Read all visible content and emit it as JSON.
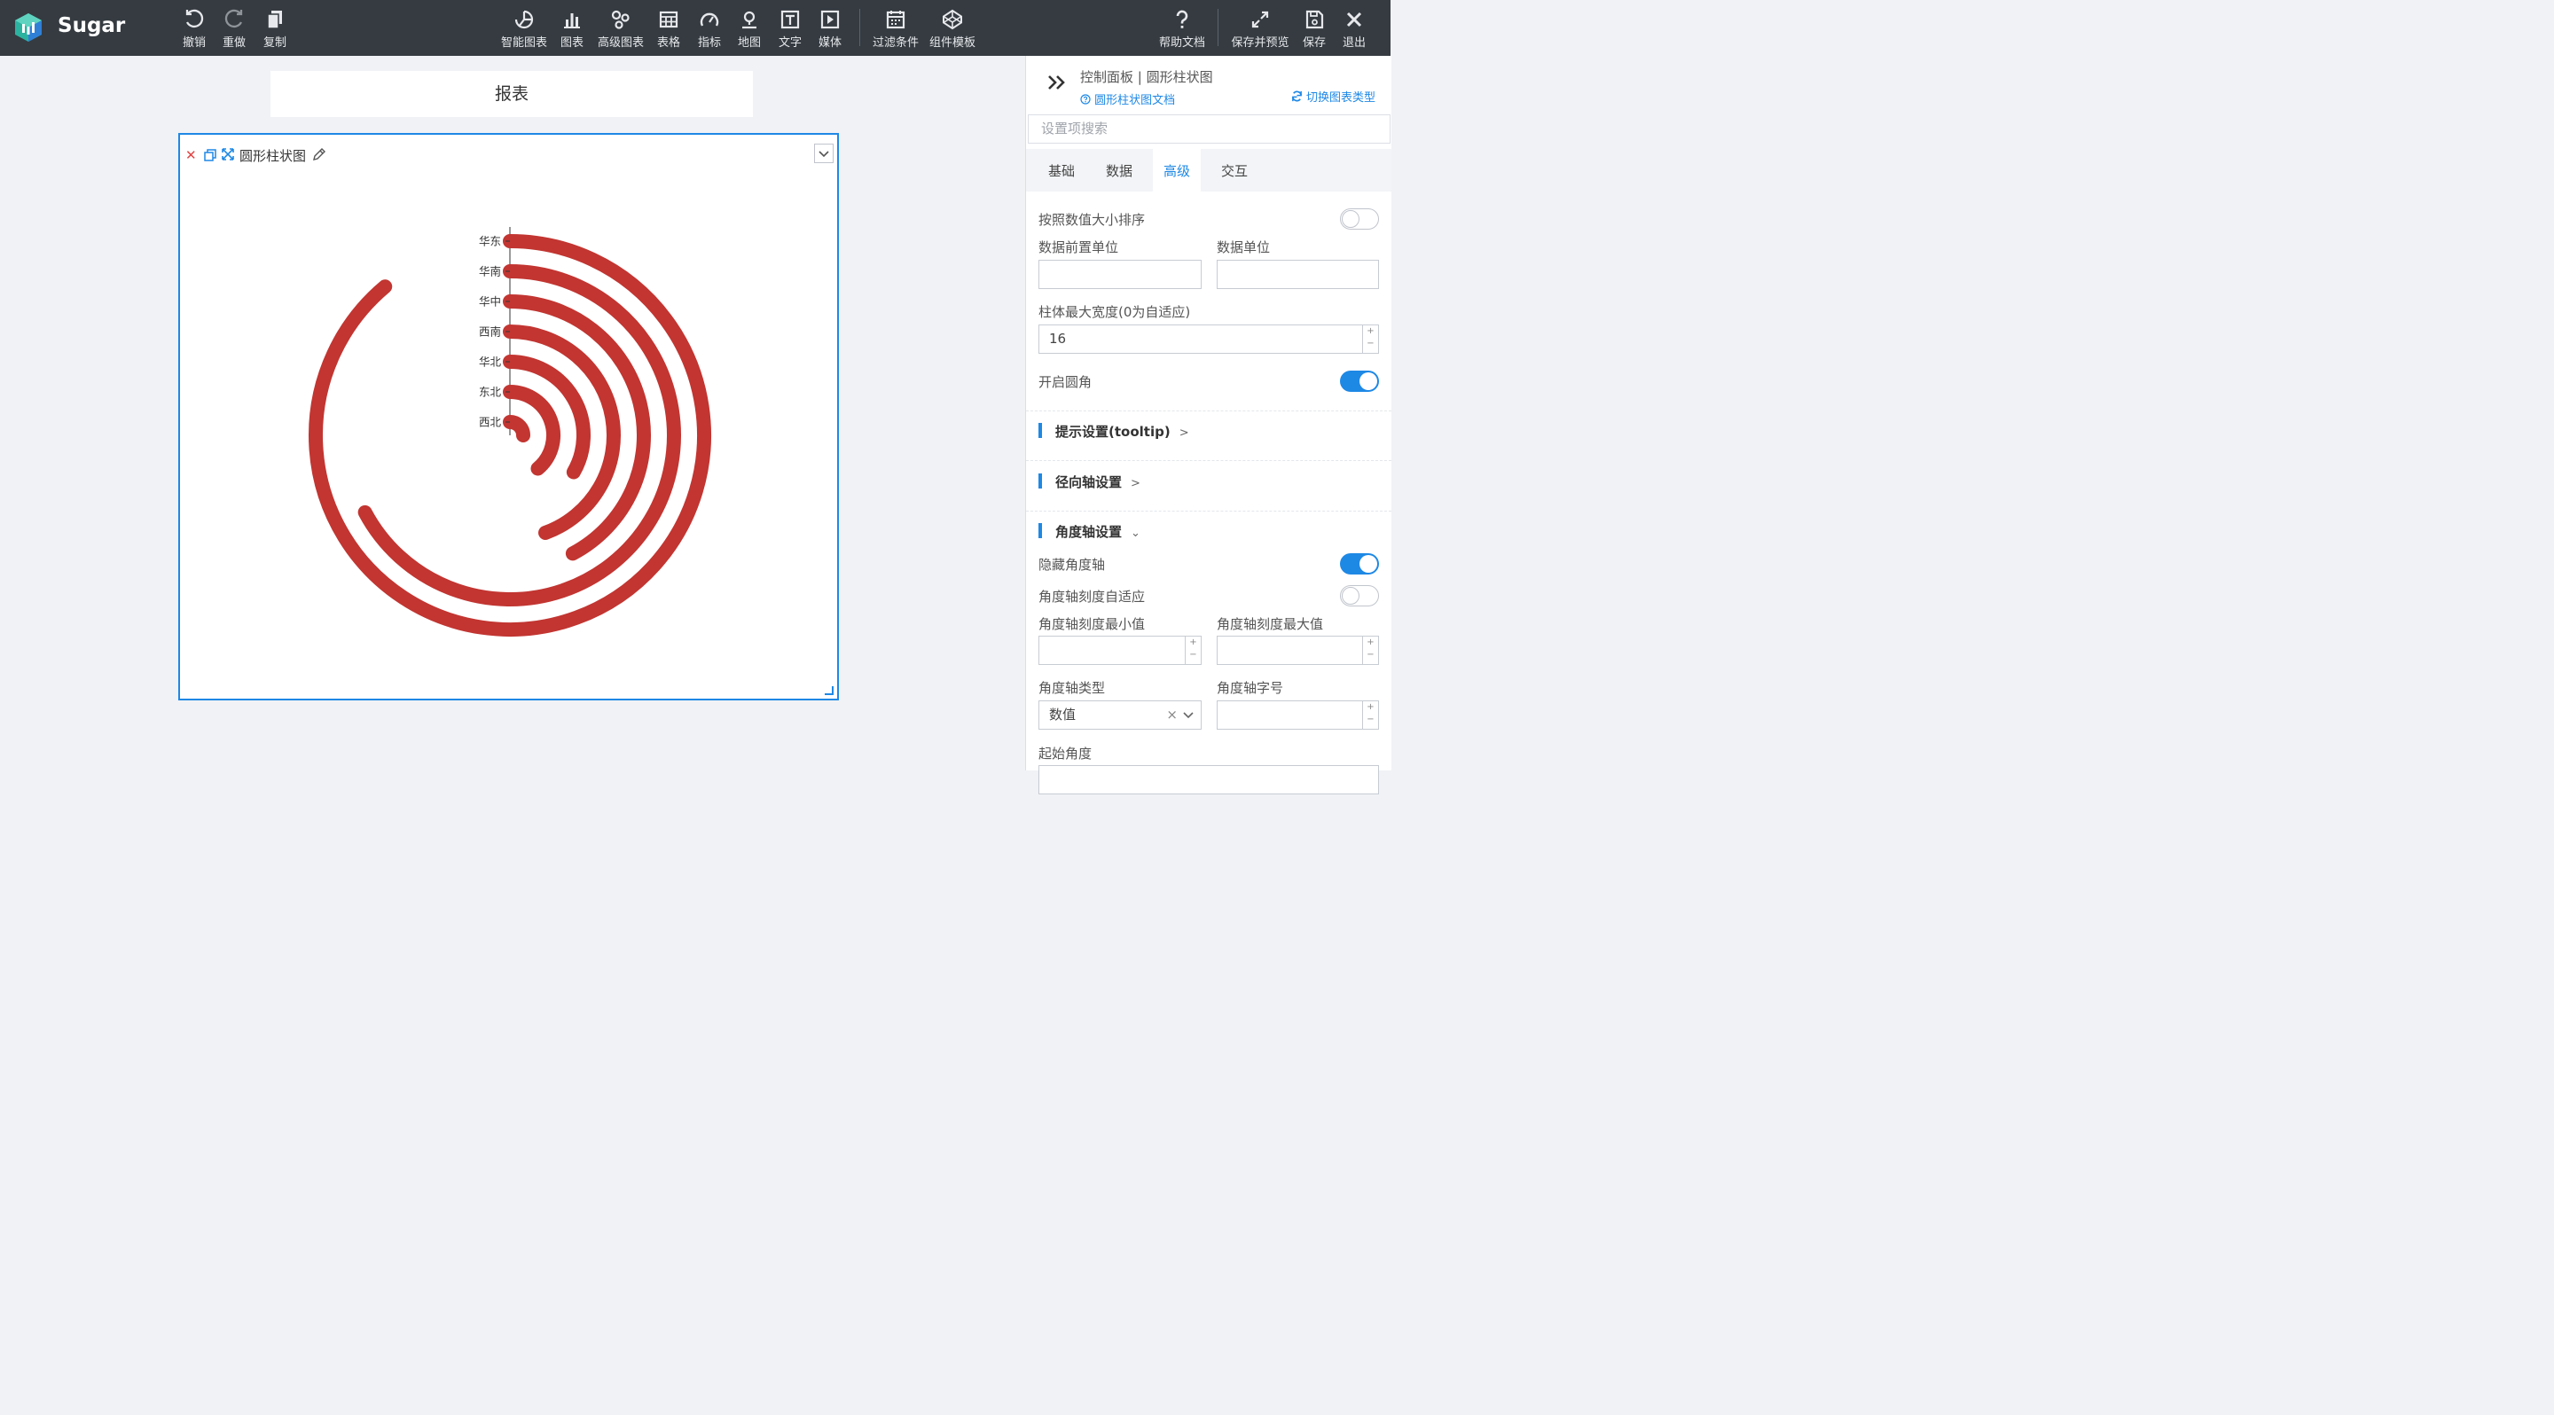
{
  "app": {
    "name": "Sugar"
  },
  "toolbar": {
    "undo": "撤销",
    "redo": "重做",
    "copy": "复制",
    "smart_chart": "智能图表",
    "chart": "图表",
    "advanced_chart": "高级图表",
    "table": "表格",
    "metric": "指标",
    "map": "地图",
    "text": "文字",
    "media": "媒体",
    "filter": "过滤条件",
    "component_template": "组件模板",
    "help": "帮助文档",
    "save_preview": "保存并预览",
    "save": "保存",
    "exit": "退出"
  },
  "page": {
    "title": "报表"
  },
  "widget": {
    "title": "圆形柱状图"
  },
  "chart_data": {
    "type": "bar",
    "subtype": "polar-radial-bar",
    "categories": [
      "华东",
      "华南",
      "华中",
      "西南",
      "华北",
      "东北",
      "西北"
    ],
    "values": [
      320,
      242,
      152,
      160,
      120,
      140,
      90
    ],
    "angle_axis": {
      "min": 0,
      "max": 360,
      "hidden": true,
      "start_angle": 90,
      "clockwise": true
    },
    "color": "#c23531",
    "rounded_corners": true,
    "bar_max_width": 16,
    "title": "",
    "xlabel": "",
    "ylabel": ""
  },
  "panel": {
    "title": "控制面板 | 圆形柱状图",
    "doc_link": "圆形柱状图文档",
    "switch_type": "切换图表类型",
    "search_placeholder": "设置项搜索",
    "tabs": [
      "基础",
      "数据",
      "高级",
      "交互"
    ],
    "active_tab": "高级",
    "sort_by_value": {
      "label": "按照数值大小排序",
      "on": false
    },
    "prefix_unit": {
      "label": "数据前置单位",
      "value": ""
    },
    "unit": {
      "label": "数据单位",
      "value": ""
    },
    "bar_max_width": {
      "label": "柱体最大宽度(0为自适应)",
      "value": "16"
    },
    "rounded": {
      "label": "开启圆角",
      "on": true
    },
    "section_tooltip": "提示设置(tooltip)",
    "section_radius_axis": "径向轴设置",
    "section_angle_axis": "角度轴设置",
    "hide_angle_axis": {
      "label": "隐藏角度轴",
      "on": true
    },
    "angle_adaptive": {
      "label": "角度轴刻度自适应",
      "on": false
    },
    "angle_min": {
      "label": "角度轴刻度最小值",
      "value": ""
    },
    "angle_max": {
      "label": "角度轴刻度最大值",
      "value": ""
    },
    "angle_type": {
      "label": "角度轴类型",
      "value": "数值"
    },
    "angle_font_size": {
      "label": "角度轴字号",
      "value": ""
    },
    "start_angle": {
      "label": "起始角度"
    }
  },
  "colors": {
    "accent": "#1e88e5",
    "topbar": "#353b41",
    "bar": "#c23531"
  }
}
